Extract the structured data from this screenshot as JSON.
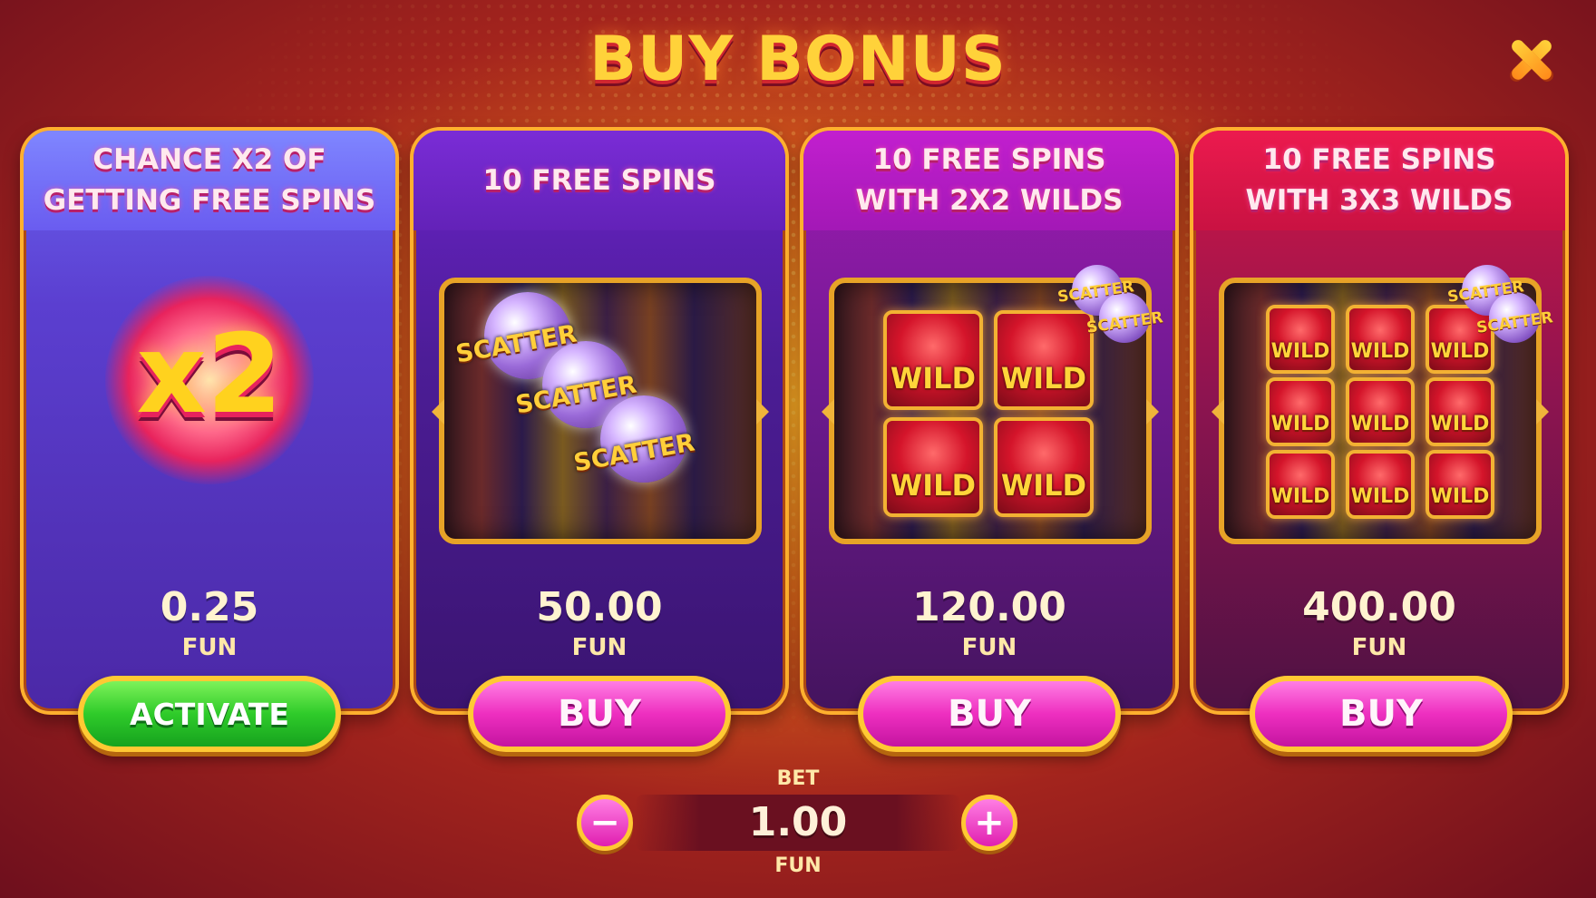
{
  "header": {
    "title": "BUY BONUS"
  },
  "cards": [
    {
      "title": "CHANCE X2 OF\nGETTING FREE SPINS",
      "price": "0.25",
      "currency": "FUN",
      "button": "ACTIVATE",
      "badge": "x2"
    },
    {
      "title": "10 FREE SPINS",
      "price": "50.00",
      "currency": "FUN",
      "button": "BUY",
      "symbol": "SCATTER"
    },
    {
      "title": "10 FREE SPINS\nWITH 2X2 WILDS",
      "price": "120.00",
      "currency": "FUN",
      "button": "BUY",
      "symbol": "WILD",
      "scatter": "SCATTER"
    },
    {
      "title": "10 FREE SPINS\nWITH 3X3 WILDS",
      "price": "400.00",
      "currency": "FUN",
      "button": "BUY",
      "symbol": "WILD",
      "scatter": "SCATTER"
    }
  ],
  "bet": {
    "label": "BET",
    "value": "1.00",
    "currency": "FUN",
    "minus": "−",
    "plus": "+"
  },
  "icons": {
    "close": "close-icon"
  },
  "colors": {
    "title": "#ffd23a",
    "activate": "#2fcb2a",
    "buy": "#ee2fc0",
    "frame": "#ffb02e"
  }
}
